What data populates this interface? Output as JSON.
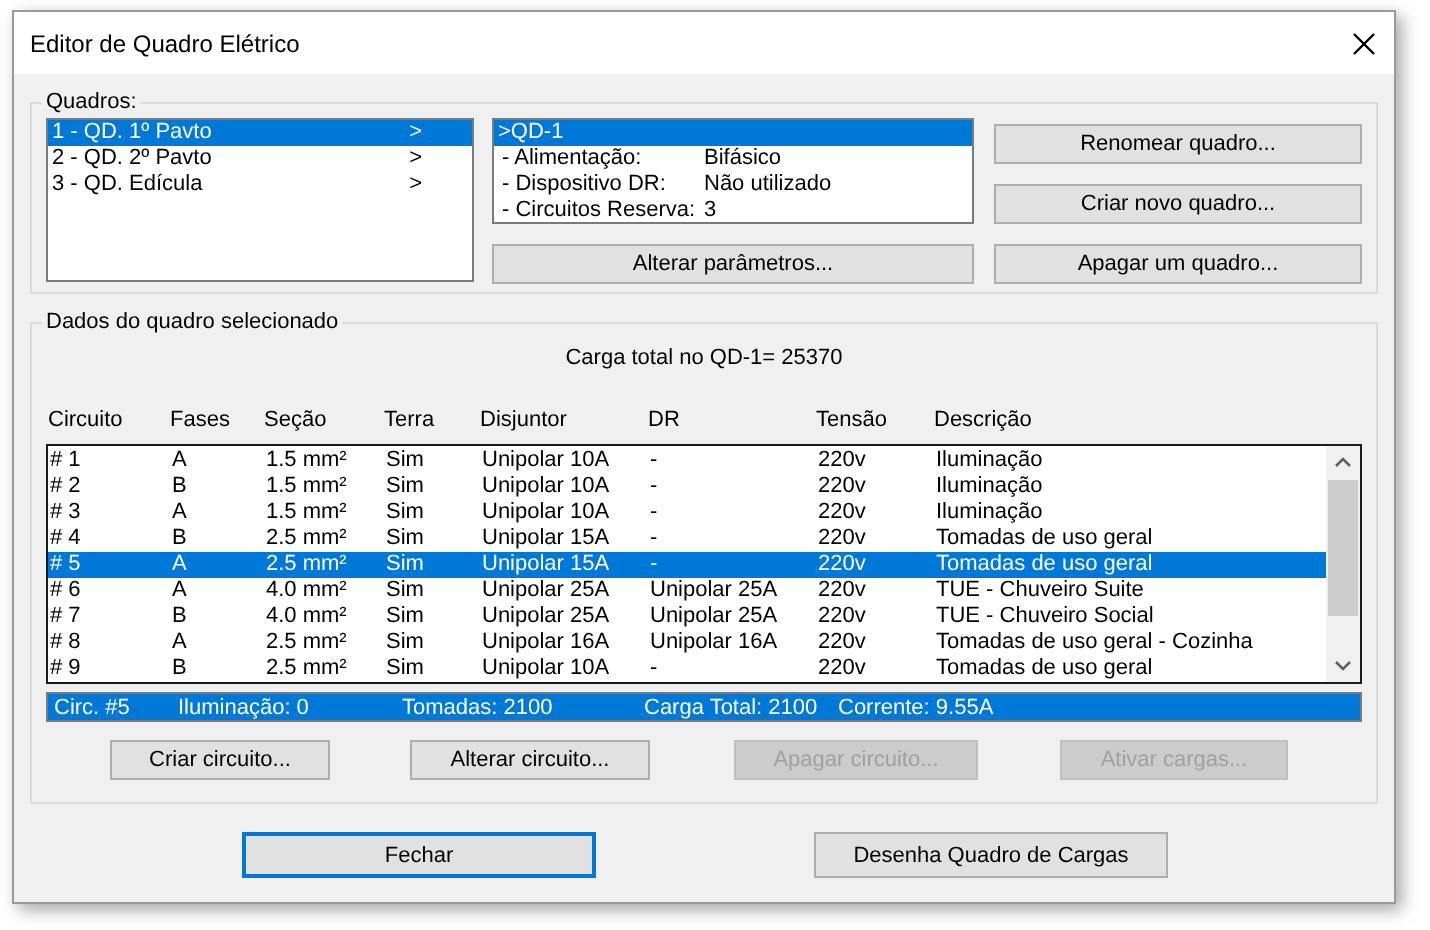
{
  "window": {
    "title": "Editor de Quadro Elétrico"
  },
  "quadros": {
    "label": "Quadros:",
    "items": [
      {
        "label": "1 - QD. 1º Pavto",
        "arrow": ">",
        "selected": true
      },
      {
        "label": "2 - QD. 2º Pavto",
        "arrow": ">",
        "selected": false
      },
      {
        "label": "3 - QD. Edícula",
        "arrow": ">",
        "selected": false
      }
    ],
    "info": {
      "header": ">QD-1",
      "header_selected": true,
      "rows": [
        {
          "label": "- Alimentação:",
          "value": "Bifásico"
        },
        {
          "label": "- Dispositivo DR:",
          "value": "Não utilizado"
        },
        {
          "label": "- Circuitos Reserva:",
          "value": "3"
        }
      ]
    },
    "params_button": "Alterar parâmetros...",
    "buttons": [
      "Renomear quadro...",
      "Criar novo quadro...",
      "Apagar um quadro..."
    ]
  },
  "dados": {
    "label": "Dados do quadro selecionado",
    "total": "Carga total no QD-1= 25370",
    "columns": [
      "Circuito",
      "Fases",
      "Seção",
      "Terra",
      "Disjuntor",
      "DR",
      "Tensão",
      "Descrição"
    ],
    "rows": [
      {
        "cells": [
          "# 1",
          "A",
          "1.5 mm²",
          "Sim",
          "Unipolar 10A",
          "-",
          "220v",
          "Iluminação"
        ],
        "selected": false
      },
      {
        "cells": [
          "# 2",
          "B",
          "1.5 mm²",
          "Sim",
          "Unipolar 10A",
          "-",
          "220v",
          "Iluminação"
        ],
        "selected": false
      },
      {
        "cells": [
          "# 3",
          "A",
          "1.5 mm²",
          "Sim",
          "Unipolar 10A",
          "-",
          "220v",
          "Iluminação"
        ],
        "selected": false
      },
      {
        "cells": [
          "# 4",
          "B",
          "2.5 mm²",
          "Sim",
          "Unipolar 15A",
          "-",
          "220v",
          "Tomadas de uso geral"
        ],
        "selected": false
      },
      {
        "cells": [
          "# 5",
          "A",
          "2.5 mm²",
          "Sim",
          "Unipolar 15A",
          "-",
          "220v",
          "Tomadas de uso geral"
        ],
        "selected": true
      },
      {
        "cells": [
          "# 6",
          "A",
          "4.0 mm²",
          "Sim",
          "Unipolar 25A",
          "Unipolar 25A",
          "220v",
          "TUE - Chuveiro Suite"
        ],
        "selected": false
      },
      {
        "cells": [
          "# 7",
          "B",
          "4.0 mm²",
          "Sim",
          "Unipolar 25A",
          "Unipolar 25A",
          "220v",
          "TUE - Chuveiro Social"
        ],
        "selected": false
      },
      {
        "cells": [
          "# 8",
          "A",
          "2.5 mm²",
          "Sim",
          "Unipolar 16A",
          "Unipolar 16A",
          "220v",
          "Tomadas de uso geral - Cozinha"
        ],
        "selected": false
      },
      {
        "cells": [
          "# 9",
          "B",
          "2.5 mm²",
          "Sim",
          "Unipolar 10A",
          "-",
          "220v",
          "Tomadas de uso geral"
        ],
        "selected": false
      }
    ],
    "status": [
      "Circ. #5",
      "Iluminação: 0",
      "Tomadas: 2100",
      "Carga Total: 2100",
      "Corrente: 9.55A"
    ],
    "buttons": [
      {
        "label": "Criar circuito...",
        "disabled": false
      },
      {
        "label": "Alterar circuito...",
        "disabled": false
      },
      {
        "label": "Apagar circuito...",
        "disabled": true
      },
      {
        "label": "Ativar cargas...",
        "disabled": true
      }
    ]
  },
  "footer": [
    {
      "label": "Fechar",
      "default": true
    },
    {
      "label": "Desenha Quadro de Cargas",
      "default": false
    }
  ]
}
